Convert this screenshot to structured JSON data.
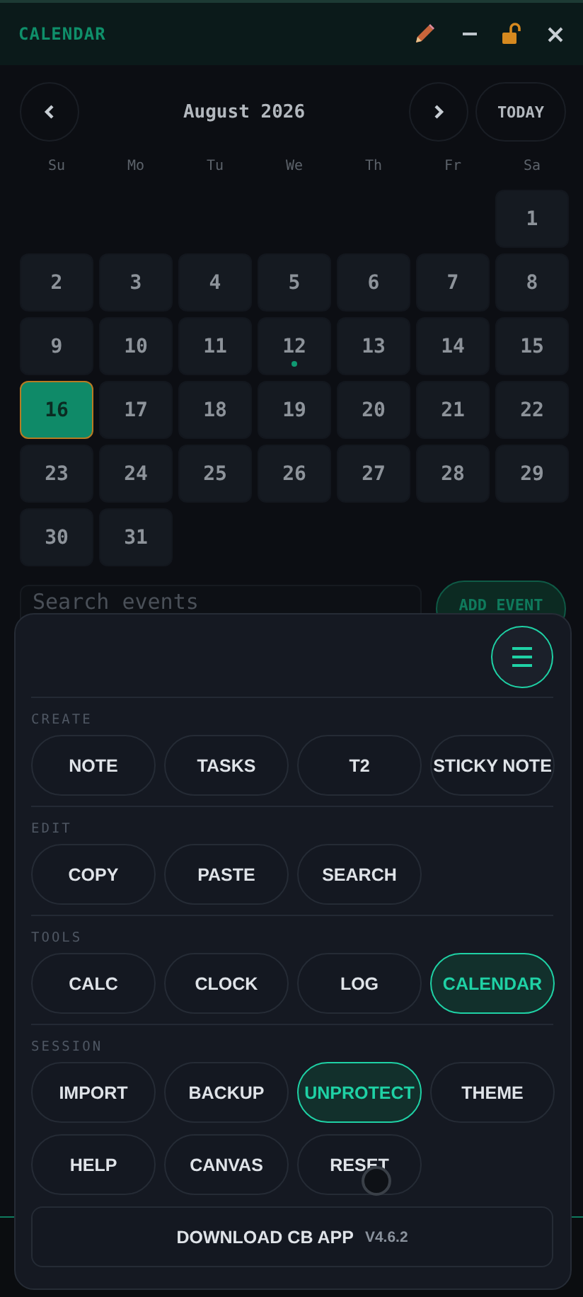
{
  "window": {
    "title": "CALENDAR"
  },
  "calendar": {
    "month": "August 2026",
    "today_label": "TODAY",
    "weekdays": [
      "Su",
      "Mo",
      "Tu",
      "We",
      "Th",
      "Fr",
      "Sa"
    ],
    "weeks": [
      [
        {
          "kind": "blank"
        },
        {
          "kind": "blank"
        },
        {
          "kind": "blank"
        },
        {
          "kind": "blank"
        },
        {
          "kind": "blank"
        },
        {
          "kind": "blank"
        },
        {
          "kind": "day",
          "day": "1",
          "selected": false,
          "event": false
        }
      ],
      [
        {
          "day": "2",
          "selected": false,
          "event": false
        },
        {
          "day": "3",
          "selected": false,
          "event": false
        },
        {
          "day": "4",
          "selected": false,
          "event": false
        },
        {
          "day": "5",
          "selected": false,
          "event": false
        },
        {
          "day": "6",
          "selected": false,
          "event": false
        },
        {
          "day": "7",
          "selected": false,
          "event": false
        },
        {
          "day": "8",
          "selected": false,
          "event": false
        }
      ],
      [
        {
          "day": "9",
          "selected": false,
          "event": false
        },
        {
          "day": "10",
          "selected": false,
          "event": false
        },
        {
          "day": "11",
          "selected": false,
          "event": false
        },
        {
          "day": "12",
          "selected": false,
          "event": true
        },
        {
          "day": "13",
          "selected": false,
          "event": false
        },
        {
          "day": "14",
          "selected": false,
          "event": false
        },
        {
          "day": "15",
          "selected": false,
          "event": false
        }
      ],
      [
        {
          "day": "16",
          "selected": true,
          "event": false
        },
        {
          "day": "17",
          "selected": false,
          "event": false
        },
        {
          "day": "18",
          "selected": false,
          "event": false
        },
        {
          "day": "19",
          "selected": false,
          "event": false
        },
        {
          "day": "20",
          "selected": false,
          "event": false
        },
        {
          "day": "21",
          "selected": false,
          "event": false
        },
        {
          "day": "22",
          "selected": false,
          "event": false
        }
      ],
      [
        {
          "day": "23",
          "selected": false,
          "event": false
        },
        {
          "day": "24",
          "selected": false,
          "event": false
        },
        {
          "day": "25",
          "selected": false,
          "event": false
        },
        {
          "day": "26",
          "selected": false,
          "event": false
        },
        {
          "day": "27",
          "selected": false,
          "event": false
        },
        {
          "day": "28",
          "selected": false,
          "event": false
        },
        {
          "day": "29",
          "selected": false,
          "event": false
        }
      ],
      [
        {
          "day": "30",
          "selected": false,
          "event": false
        },
        {
          "day": "31",
          "selected": false,
          "event": false
        }
      ]
    ],
    "search": {
      "placeholder": "Search events"
    },
    "add_label": "ADD EVENT"
  },
  "menu": {
    "sections": [
      {
        "label": "CREATE",
        "buttons": [
          {
            "label": "NOTE",
            "selected": false
          },
          {
            "label": "TASKS",
            "selected": false
          },
          {
            "label": "T2",
            "selected": false
          },
          {
            "label": "STICKY NOTE",
            "selected": false
          }
        ]
      },
      {
        "label": "EDIT",
        "buttons": [
          {
            "label": "COPY",
            "selected": false
          },
          {
            "label": "PASTE",
            "selected": false
          },
          {
            "label": "SEARCH",
            "selected": false
          }
        ]
      },
      {
        "label": "TOOLS",
        "buttons": [
          {
            "label": "CALC",
            "selected": false
          },
          {
            "label": "CLOCK",
            "selected": false
          },
          {
            "label": "LOG",
            "selected": false
          },
          {
            "label": "CALENDAR",
            "selected": true
          }
        ]
      },
      {
        "label": "SESSION",
        "buttons": [
          {
            "label": "IMPORT",
            "selected": false
          },
          {
            "label": "BACKUP",
            "selected": false
          },
          {
            "label": "UNPROTECT",
            "selected": true
          },
          {
            "label": "THEME",
            "selected": false
          },
          {
            "label": "HELP",
            "selected": false
          },
          {
            "label": "CANVAS",
            "selected": false
          },
          {
            "label": "RESET",
            "selected": false
          }
        ]
      }
    ],
    "download": {
      "label": "DOWNLOAD CB APP",
      "version": "V4.6.2"
    }
  }
}
